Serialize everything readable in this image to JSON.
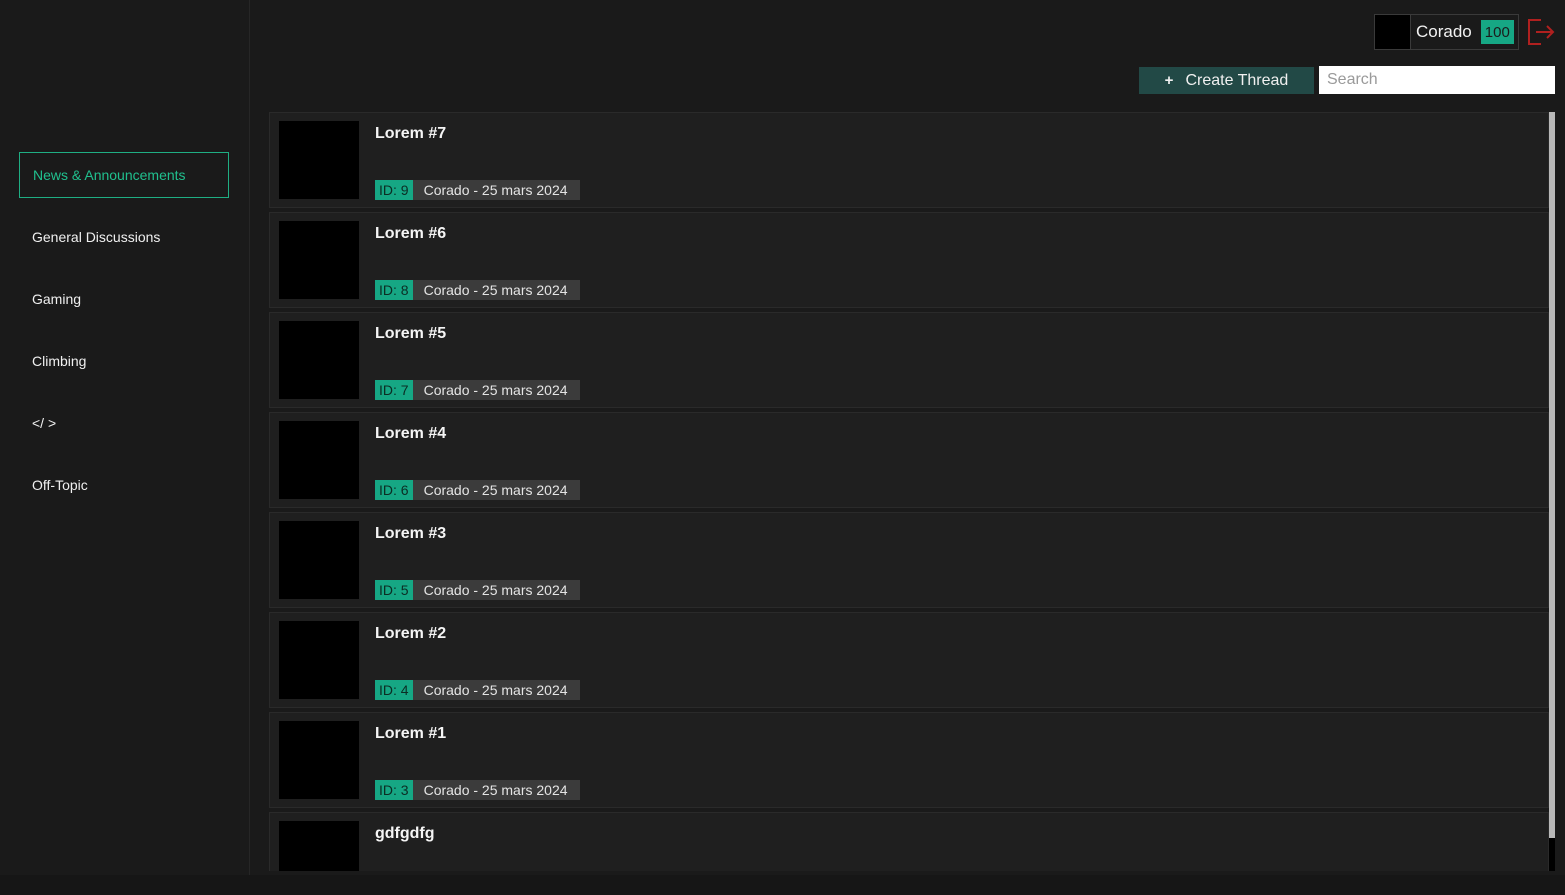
{
  "sidebar": {
    "items": [
      {
        "label": "News & Announcements",
        "active": true
      },
      {
        "label": "General Discussions"
      },
      {
        "label": "Gaming"
      },
      {
        "label": "Climbing"
      },
      {
        "label": "</ >"
      },
      {
        "label": "Off-Topic"
      }
    ]
  },
  "header": {
    "user_name": "Corado",
    "user_points": "100",
    "logout_icon": "logout-icon"
  },
  "actions": {
    "create_label": "Create Thread",
    "create_icon": "+",
    "search_placeholder": "Search"
  },
  "threads": [
    {
      "title": "Lorem #7",
      "id": "ID: 9",
      "meta": "Corado - 25 mars 2024"
    },
    {
      "title": "Lorem #6",
      "id": "ID: 8",
      "meta": "Corado - 25 mars 2024"
    },
    {
      "title": "Lorem #5",
      "id": "ID: 7",
      "meta": "Corado - 25 mars 2024"
    },
    {
      "title": "Lorem #4",
      "id": "ID: 6",
      "meta": "Corado - 25 mars 2024"
    },
    {
      "title": "Lorem #3",
      "id": "ID: 5",
      "meta": "Corado - 25 mars 2024"
    },
    {
      "title": "Lorem #2",
      "id": "ID: 4",
      "meta": "Corado - 25 mars 2024"
    },
    {
      "title": "Lorem #1",
      "id": "ID: 3",
      "meta": "Corado - 25 mars 2024"
    },
    {
      "title": "gdfgdfg",
      "id": "",
      "meta": ""
    }
  ],
  "colors": {
    "accent": "#16a784",
    "background": "#1a1a1a",
    "logout": "#b0201f"
  }
}
